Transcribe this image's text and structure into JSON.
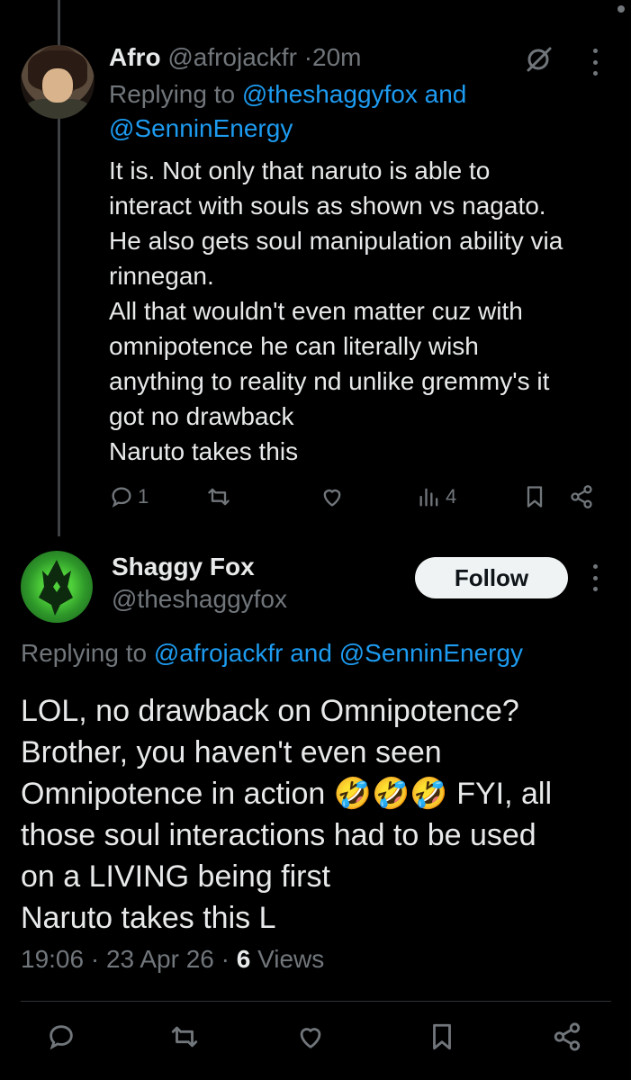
{
  "reply": {
    "name": "Afro",
    "handle": "@afrojackfr",
    "separator": "·",
    "time": "20m",
    "replying_prefix": "Replying to",
    "replying_mention_1": "@theshaggyfox",
    "replying_and": "and",
    "replying_mention_2": "@SenninEnergy",
    "text_lines": [
      "It is. Not only that naruto is able to",
      "interact with souls as shown vs nagato.",
      "He also gets soul manipulation ability via",
      "rinnegan.",
      "All that wouldn't even matter cuz with",
      "omnipotence he can literally wish",
      "anything to reality nd unlike gremmy's it",
      "got no drawback",
      "Naruto takes this"
    ],
    "reply_count": "1",
    "views_count": "4",
    "icons": [
      "grok-icon",
      "more-icon",
      "reply-icon",
      "retweet-icon",
      "like-icon",
      "views-icon",
      "bookmark-icon",
      "share-icon"
    ]
  },
  "main": {
    "name": "Shaggy Fox",
    "handle": "@theshaggyfox",
    "follow_label": "Follow",
    "replying_prefix": "Replying to",
    "replying_mention_1": "@afrojackfr",
    "replying_and": "and",
    "replying_mention_2": "@SenninEnergy",
    "text_lines": [
      "LOL, no drawback on Omnipotence?",
      "Brother, you haven't even seen",
      "Omnipotence in action 🤣🤣🤣 FYI, all",
      "those soul interactions had to be used",
      "on a LIVING being first",
      "Naruto takes this L"
    ],
    "time": "19:06",
    "separator": "·",
    "date": "23 Apr 26",
    "views_count": "6",
    "views_label": "Views",
    "icons": [
      "reply-icon",
      "retweet-icon",
      "like-icon",
      "bookmark-icon",
      "share-icon"
    ]
  },
  "colors": {
    "background": "#000000",
    "text": "#e7e9ea",
    "muted": "#71767b",
    "link": "#1d9bf0",
    "follow_bg": "#eff3f4",
    "thread_line": "#3e4144"
  }
}
